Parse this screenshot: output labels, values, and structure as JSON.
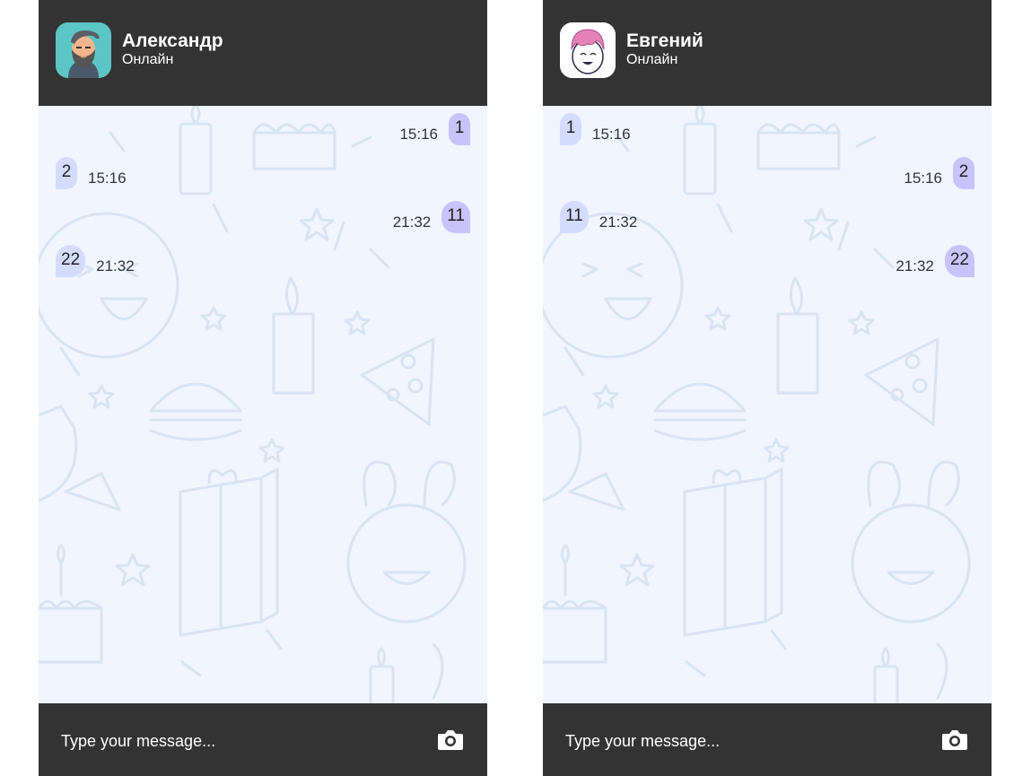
{
  "chats": [
    {
      "contact": {
        "name": "Александр",
        "status": "Онлайн",
        "avatar_bg": "#5cc6c5"
      },
      "messages": [
        {
          "text": "1",
          "time": "15:16",
          "direction": "out"
        },
        {
          "text": "2",
          "time": "15:16",
          "direction": "in"
        },
        {
          "text": "11",
          "time": "21:32",
          "direction": "out"
        },
        {
          "text": "22",
          "time": "21:32",
          "direction": "in"
        }
      ],
      "composer": {
        "placeholder": "Type your message..."
      }
    },
    {
      "contact": {
        "name": "Евгений",
        "status": "Онлайн",
        "avatar_bg": "#ffffff"
      },
      "messages": [
        {
          "text": "1",
          "time": "15:16",
          "direction": "in"
        },
        {
          "text": "2",
          "time": "15:16",
          "direction": "out"
        },
        {
          "text": "11",
          "time": "21:32",
          "direction": "in"
        },
        {
          "text": "22",
          "time": "21:32",
          "direction": "out"
        }
      ],
      "composer": {
        "placeholder": "Type your message..."
      }
    }
  ],
  "colors": {
    "header_bg": "#333333",
    "chat_bg": "#f0f5ff",
    "bubble_out": "#c8c3fb",
    "bubble_in": "#d4dcfd"
  }
}
